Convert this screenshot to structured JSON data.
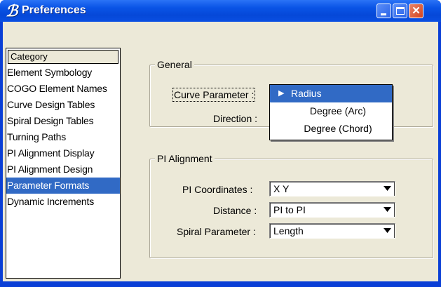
{
  "window": {
    "title": "Preferences",
    "colors": {
      "titlebar": "#0a54e6",
      "selection": "#316ac5",
      "face": "#ece9d8"
    }
  },
  "titlebar_buttons": {
    "minimize_icon": "minimize-icon",
    "maximize_icon": "maximize-icon",
    "close_icon": "close-icon",
    "close_glyph": "✕"
  },
  "category": {
    "header": "Category",
    "items": [
      {
        "label": "Element Symbology",
        "selected": false
      },
      {
        "label": "COGO Element Names",
        "selected": false
      },
      {
        "label": "Curve Design Tables",
        "selected": false
      },
      {
        "label": "Spiral Design Tables",
        "selected": false
      },
      {
        "label": "Turning Paths",
        "selected": false
      },
      {
        "label": "PI Alignment Display",
        "selected": false
      },
      {
        "label": "PI Alignment Design",
        "selected": false
      },
      {
        "label": "Parameter Formats",
        "selected": true
      },
      {
        "label": "Dynamic Increments",
        "selected": false
      }
    ]
  },
  "general": {
    "legend": "General",
    "curve_parameter_label": "Curve Parameter :",
    "direction_label": "Direction :",
    "curve_parameter_options": [
      "Radius",
      "Degree (Arc)",
      "Degree (Chord)"
    ],
    "curve_parameter_selected": "Radius"
  },
  "pi_alignment": {
    "legend": "PI Alignment",
    "pi_coordinates_label": "PI Coordinates :",
    "pi_coordinates_value": "X Y",
    "distance_label": "Distance :",
    "distance_value": "PI to PI",
    "spiral_parameter_label": "Spiral Parameter :",
    "spiral_parameter_value": "Length"
  }
}
